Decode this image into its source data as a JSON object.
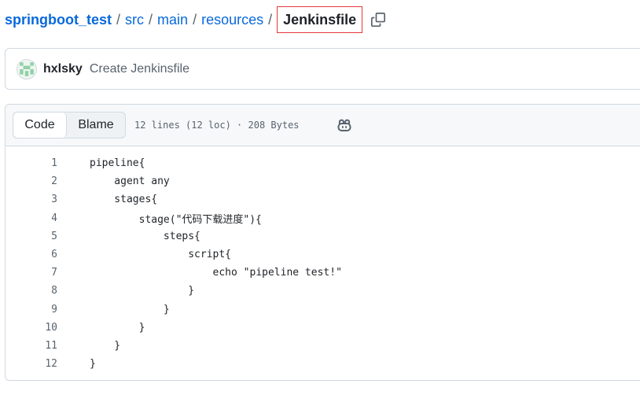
{
  "breadcrumb": {
    "repo": "springboot_test",
    "separator": "/",
    "path": [
      "src",
      "main",
      "resources"
    ],
    "current": "Jenkinsfile",
    "copy_icon": "copy-icon"
  },
  "commit": {
    "avatar_icon": "identicon-avatar",
    "author": "hxlsky",
    "message": "Create Jenkinsfile"
  },
  "code_header": {
    "tabs": [
      {
        "label": "Code",
        "active": true
      },
      {
        "label": "Blame",
        "active": false
      }
    ],
    "file_info": "12 lines (12 loc) · 208 Bytes",
    "copilot_icon": "copilot-icon"
  },
  "code": {
    "lines": [
      {
        "num": "1",
        "text": "pipeline{"
      },
      {
        "num": "2",
        "text": "    agent any"
      },
      {
        "num": "3",
        "text": "    stages{"
      },
      {
        "num": "4",
        "text": "        stage(\"代码下载进度\"){"
      },
      {
        "num": "5",
        "text": "            steps{"
      },
      {
        "num": "6",
        "text": "                script{"
      },
      {
        "num": "7",
        "text": "                    echo \"pipeline test!\""
      },
      {
        "num": "8",
        "text": "                }"
      },
      {
        "num": "9",
        "text": "            }"
      },
      {
        "num": "10",
        "text": "        }"
      },
      {
        "num": "11",
        "text": "    }"
      },
      {
        "num": "12",
        "text": "}"
      }
    ]
  }
}
